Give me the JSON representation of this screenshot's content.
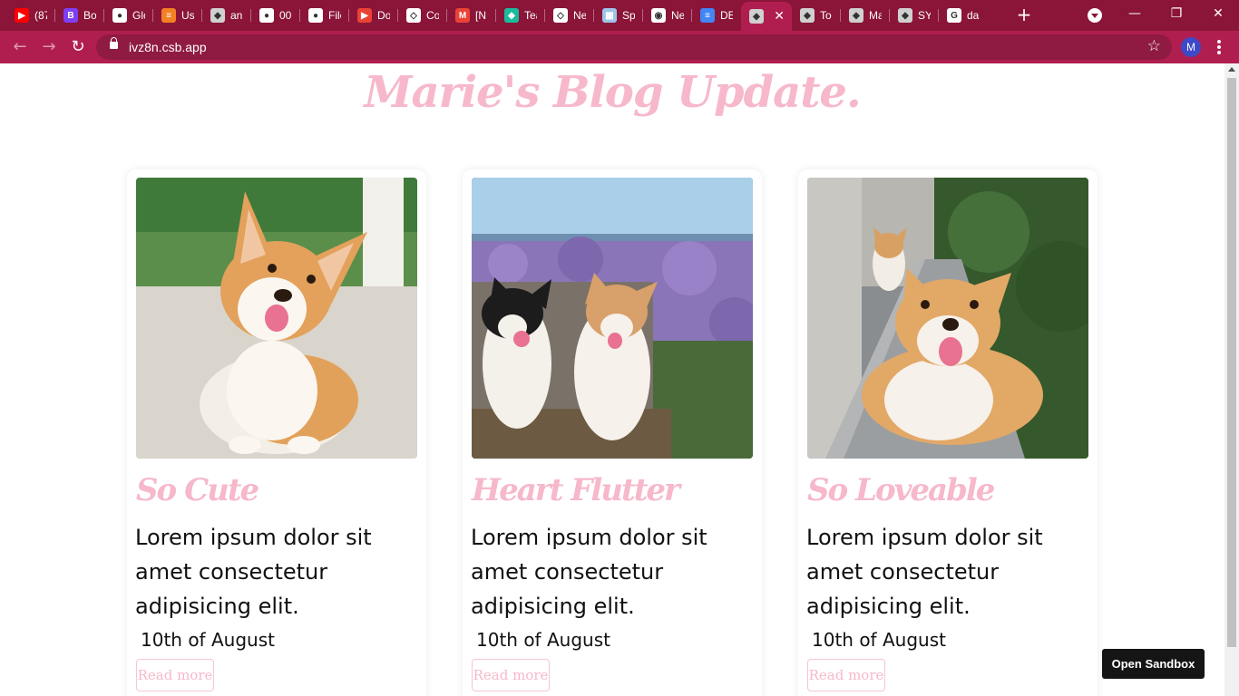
{
  "browser": {
    "tabs": [
      {
        "title": "(87",
        "color": "#ff0000",
        "glyph": "▶"
      },
      {
        "title": "Bo",
        "color": "#7e3ff2",
        "glyph": "B"
      },
      {
        "title": "Glo",
        "color": "#ffffff",
        "glyph": "●"
      },
      {
        "title": "Usi",
        "color": "#f48024",
        "glyph": "≡"
      },
      {
        "title": "an",
        "color": "#d0d0d0",
        "glyph": "◆"
      },
      {
        "title": "00",
        "color": "#ffffff",
        "glyph": "●"
      },
      {
        "title": "File",
        "color": "#ffffff",
        "glyph": "●"
      },
      {
        "title": "Do",
        "color": "#ea4335",
        "glyph": "▶"
      },
      {
        "title": "Co",
        "color": "#ffffff",
        "glyph": "◇"
      },
      {
        "title": "[N",
        "color": "#ea4335",
        "glyph": "M"
      },
      {
        "title": "Tea",
        "color": "#1abc9c",
        "glyph": "◆"
      },
      {
        "title": "Ne",
        "color": "#ffffff",
        "glyph": "◇"
      },
      {
        "title": "Spr",
        "color": "#9ec5e8",
        "glyph": "▦"
      },
      {
        "title": "Ne",
        "color": "#ffffff",
        "glyph": "◉"
      },
      {
        "title": "DE",
        "color": "#4285f4",
        "glyph": "≡"
      },
      {
        "title": "",
        "color": "#d0d0d0",
        "glyph": "◆"
      },
      {
        "title": "To",
        "color": "#d0d0d0",
        "glyph": "◆"
      },
      {
        "title": "Ma",
        "color": "#d0d0d0",
        "glyph": "◆"
      },
      {
        "title": "SY",
        "color": "#d0d0d0",
        "glyph": "◆"
      },
      {
        "title": "da",
        "color": "#ffffff",
        "glyph": "G"
      }
    ],
    "active_tab_index": 15,
    "new_tab": "+",
    "url": "ivz8n.csb.app",
    "profile_initial": "M",
    "accent": "#b01e4f",
    "tabstrip_color": "#8a1538"
  },
  "page": {
    "title": "Marie's Blog Update.",
    "title_color": "#f6b8ca",
    "cards": [
      {
        "title": "So Cute",
        "body": "Lorem ipsum dolor sit amet consectetur adipisicing elit.",
        "date": "10th of August",
        "button": "Read more",
        "image": "corgi puppy sitting on a porch"
      },
      {
        "title": "Heart Flutter",
        "body": "Lorem ipsum dolor sit amet consectetur adipisicing elit.",
        "date": "10th of August",
        "button": "Read more",
        "image": "two corgis in front of purple flowers"
      },
      {
        "title": "So Loveable",
        "body": "Lorem ipsum dolor sit amet consectetur adipisicing elit.",
        "date": "10th of August",
        "button": "Read more",
        "image": "two corgis on a garden path"
      }
    ]
  },
  "sandbox_button": "Open Sandbox"
}
